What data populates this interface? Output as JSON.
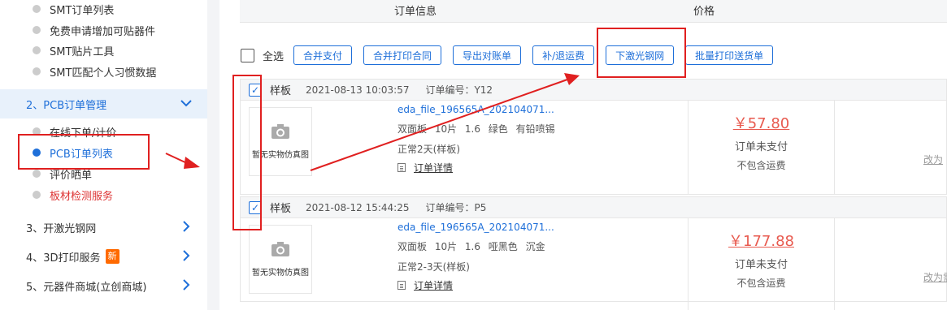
{
  "sidebar": {
    "smt_items": [
      {
        "label": "SMT订单列表"
      },
      {
        "label": "免费申请增加可贴器件"
      },
      {
        "label": "SMT贴片工具"
      },
      {
        "label": "SMT匹配个人习惯数据"
      }
    ],
    "pcb_section": "2、PCB订单管理",
    "pcb_items": [
      {
        "label": "在线下单/计价"
      },
      {
        "label": "PCB订单列表"
      },
      {
        "label": "评价晒单"
      },
      {
        "label": "板材检测服务"
      }
    ],
    "sections": [
      {
        "label": "3、开激光钢网"
      },
      {
        "label": "4、3D打印服务"
      },
      {
        "label": "5、元器件商城(立创商城)"
      }
    ],
    "new_badge": "新"
  },
  "header": {
    "col_info": "订单信息",
    "col_price": "价格"
  },
  "toolbar": {
    "select_all": "全选",
    "buttons": [
      "合并支付",
      "合并打印合同",
      "导出对账单",
      "补/退运费",
      "下激光钢网",
      "批量打印送货单"
    ]
  },
  "orders": [
    {
      "type": "样板",
      "datetime": "2021-08-13 10:03:57",
      "order_no": "订单编号：Y12",
      "thumb_text": "暂无实物仿真图",
      "file": "eda_file_196565A_202104071...",
      "spec": "双面板 10片 1.6 绿色 有铅喷锡",
      "lead_time": "正常2天(样板)",
      "detail": "订单详情",
      "price": "￥57.80",
      "status": "订单未支付",
      "note": "不包含运费",
      "action": "改为"
    },
    {
      "type": "样板",
      "datetime": "2021-08-12 15:44:25",
      "order_no": "订单编号：P5",
      "thumb_text": "暂无实物仿真图",
      "file": "eda_file_196565A_202104071...",
      "spec": "双面板 10片 1.6 哑黑色 沉金",
      "lead_time": "正常2-3天(样板)",
      "detail": "订单详情",
      "price": "￥177.88",
      "status": "订单未支付",
      "note": "不包含运费",
      "action": "改为需"
    }
  ],
  "colors": {
    "accent": "#1e6fd9",
    "price": "#e85a4f",
    "annotation": "#e02020",
    "badge": "#ff6a00"
  }
}
